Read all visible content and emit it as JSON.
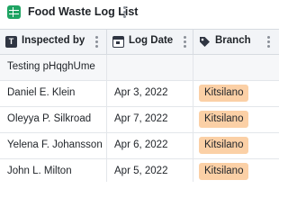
{
  "app": {
    "title": "Food Waste Log List"
  },
  "table": {
    "columns": [
      {
        "label": "Inspected by",
        "icon": "text-field-icon"
      },
      {
        "label": "Log Date",
        "icon": "calendar-icon"
      },
      {
        "label": "Branch",
        "icon": "tag-icon"
      }
    ],
    "rows": [
      {
        "inspected_by": "Testing pHqghUme",
        "log_date": "",
        "branch": ""
      },
      {
        "inspected_by": "Daniel E. Klein",
        "log_date": "Apr 3, 2022",
        "branch": "Kitsilano"
      },
      {
        "inspected_by": "Oleyya P. Silkroad",
        "log_date": "Apr 7, 2022",
        "branch": "Kitsilano"
      },
      {
        "inspected_by": "Yelena F. Johansson",
        "log_date": "Apr 6, 2022",
        "branch": "Kitsilano"
      },
      {
        "inspected_by": "John L. Milton",
        "log_date": "Apr 5, 2022",
        "branch": "Kitsilano"
      }
    ]
  },
  "colors": {
    "accent": "#1fa463",
    "badge": "#fbd0a6",
    "header_bg": "#f2f4f7"
  }
}
